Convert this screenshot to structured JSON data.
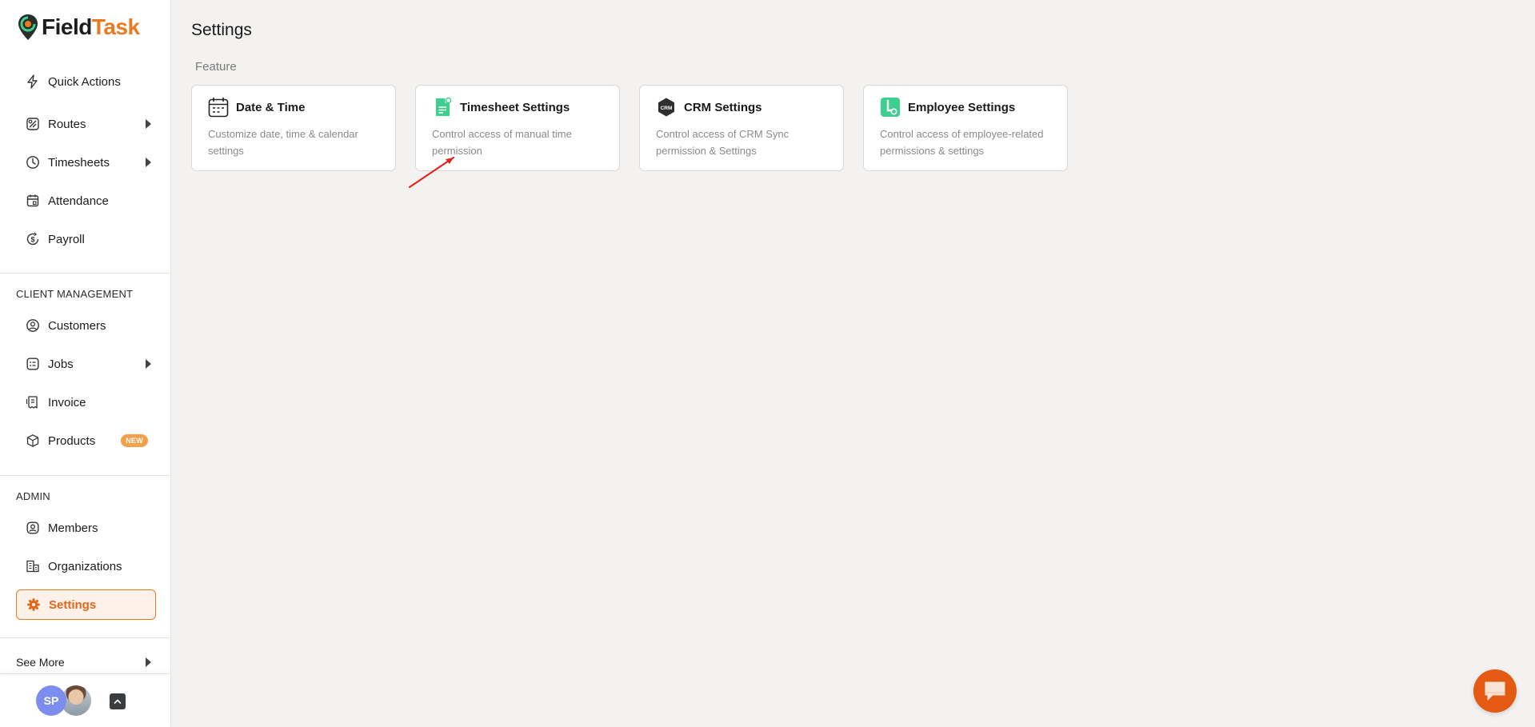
{
  "app": {
    "logo_part1": "Field",
    "logo_part2": "Task",
    "brand_color": "#ea7a1f"
  },
  "sidebar": {
    "items": [
      {
        "label": "Quick Actions",
        "icon": "lightning-icon"
      },
      {
        "label": "Routes",
        "icon": "map-icon",
        "has_submenu": true
      },
      {
        "label": "Timesheets",
        "icon": "clock-icon",
        "has_submenu": true
      },
      {
        "label": "Attendance",
        "icon": "calendar-check-icon"
      },
      {
        "label": "Payroll",
        "icon": "dollar-cycle-icon"
      }
    ],
    "client_section_label": "CLIENT MANAGEMENT",
    "client_items": [
      {
        "label": "Customers",
        "icon": "user-circle-icon"
      },
      {
        "label": "Jobs",
        "icon": "jobs-list-icon",
        "has_submenu": true
      },
      {
        "label": "Invoice",
        "icon": "receipt-icon"
      },
      {
        "label": "Products",
        "icon": "box-icon",
        "badge": "NEW"
      }
    ],
    "admin_section_label": "ADMIN",
    "admin_items": [
      {
        "label": "Members",
        "icon": "member-icon"
      },
      {
        "label": "Organizations",
        "icon": "building-icon"
      },
      {
        "label": "Settings",
        "icon": "gear-icon",
        "active": true
      }
    ],
    "see_more_label": "See More",
    "user": {
      "initials": "SP",
      "avatar_color": "#7b8ef0"
    }
  },
  "main": {
    "title": "Settings",
    "section_label": "Feature",
    "cards": [
      {
        "title": "Date & Time",
        "description": "Customize date, time & calendar settings",
        "icon": "calendar-icon"
      },
      {
        "title": "Timesheet Settings",
        "description": "Control access of manual time permission",
        "icon": "timesheet-doc-icon"
      },
      {
        "title": "CRM Settings",
        "description": "Control access of CRM Sync permission & Settings",
        "icon": "crm-hex-icon"
      },
      {
        "title": "Employee Settings",
        "description": "Control access of employee-related permissions & settings",
        "icon": "employee-badge-icon"
      }
    ]
  },
  "colors": {
    "accent_orange": "#ea7a1f",
    "card_icon_green": "#3ecf8e",
    "annotation_red": "#e0241e",
    "chat_button": "#e55a12"
  }
}
